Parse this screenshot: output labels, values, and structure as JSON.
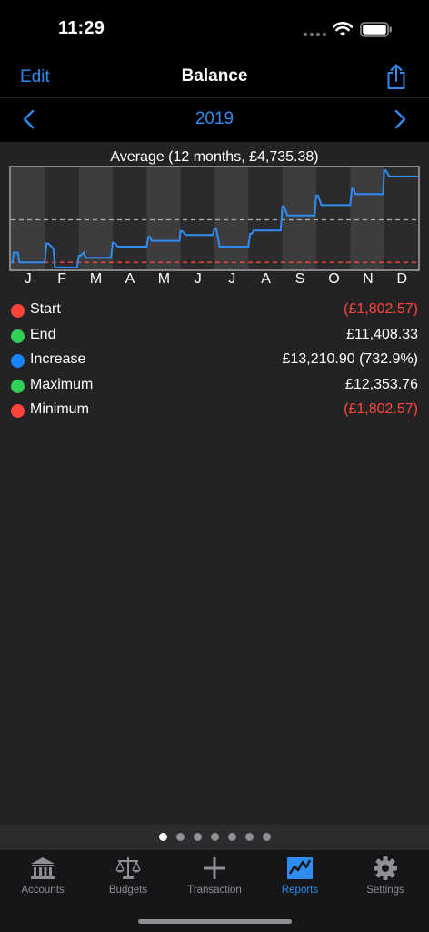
{
  "status_bar": {
    "time": "11:29"
  },
  "nav": {
    "edit_label": "Edit",
    "title": "Balance"
  },
  "period": {
    "year": "2019"
  },
  "chart_data": {
    "type": "line",
    "title": "Average (12 months, £4,735.38)",
    "x_tick_labels": [
      "J",
      "F",
      "M",
      "A",
      "M",
      "J",
      "J",
      "A",
      "S",
      "O",
      "N",
      "D"
    ],
    "x_range": [
      0,
      12
    ],
    "ylim": [
      -2900,
      12800
    ],
    "grid": false,
    "series": [
      {
        "color": "#2f8cf0",
        "x": [
          0,
          0.05,
          0.08,
          0.2,
          0.25,
          1.0,
          1.05,
          1.1,
          1.25,
          1.3,
          1.95,
          2.0,
          2.05,
          2.15,
          2.2,
          2.95,
          3.0,
          3.05,
          3.15,
          3.2,
          4.0,
          4.05,
          4.1,
          4.15,
          4.2,
          4.97,
          5.0,
          5.05,
          5.15,
          5.2,
          5.95,
          6.0,
          6.05,
          6.15,
          6.2,
          7.0,
          7.05,
          7.1,
          7.15,
          7.2,
          7.95,
          8.0,
          8.05,
          8.15,
          8.2,
          8.95,
          9.0,
          9.05,
          9.15,
          9.2,
          10.0,
          10.05,
          10.1,
          10.15,
          10.2,
          10.97,
          11.0,
          11.05,
          11.15,
          11.2,
          12.0
        ],
        "y": [
          -1802.57,
          -1802.57,
          -300,
          -300,
          -1802.57,
          -1802.57,
          1100,
          1100,
          300,
          -2600,
          -2600,
          -800,
          -800,
          -300,
          -1100,
          -1100,
          1200,
          1200,
          600,
          600,
          600,
          2100,
          2100,
          1500,
          1500,
          1500,
          3000,
          3000,
          2400,
          2400,
          2400,
          3400,
          3400,
          600,
          600,
          600,
          2600,
          2600,
          3100,
          3100,
          3100,
          6800,
          6800,
          5400,
          5400,
          5400,
          8500,
          8500,
          7000,
          7000,
          7000,
          9500,
          9500,
          8700,
          8700,
          8700,
          12353.76,
          12353.76,
          11408.33,
          11408.33,
          11408.33
        ]
      }
    ],
    "reference_lines": [
      {
        "kind": "average",
        "value": 4735.38,
        "color": "#b0b0b0"
      },
      {
        "kind": "minimum",
        "value": -1802.57,
        "color": "#ff453a"
      }
    ]
  },
  "stats": [
    {
      "label": "Start",
      "value": "(£1,802.57)",
      "dot_color": "#ff453a",
      "negative": true
    },
    {
      "label": "End",
      "value": "£11,408.33",
      "dot_color": "#30d158",
      "negative": false
    },
    {
      "label": "Increase",
      "value": "£13,210.90 (732.9%)",
      "dot_color": "#1a84ff",
      "negative": false
    },
    {
      "label": "Maximum",
      "value": "£12,353.76",
      "dot_color": "#30d158",
      "negative": false
    },
    {
      "label": "Minimum",
      "value": "(£1,802.57)",
      "dot_color": "#ff453a",
      "negative": true
    }
  ],
  "pager": {
    "count": 7,
    "active_index": 0
  },
  "tabs": [
    {
      "label": "Accounts",
      "icon": "bank-icon",
      "active": false
    },
    {
      "label": "Budgets",
      "icon": "scales-icon",
      "active": false
    },
    {
      "label": "Transaction",
      "icon": "plus-icon",
      "active": false
    },
    {
      "label": "Reports",
      "icon": "chart-icon",
      "active": true
    },
    {
      "label": "Settings",
      "icon": "gear-icon",
      "active": false
    }
  ],
  "colors": {
    "accent": "#2f8cf0",
    "negative": "#ff453a",
    "positive": "#30d158"
  }
}
